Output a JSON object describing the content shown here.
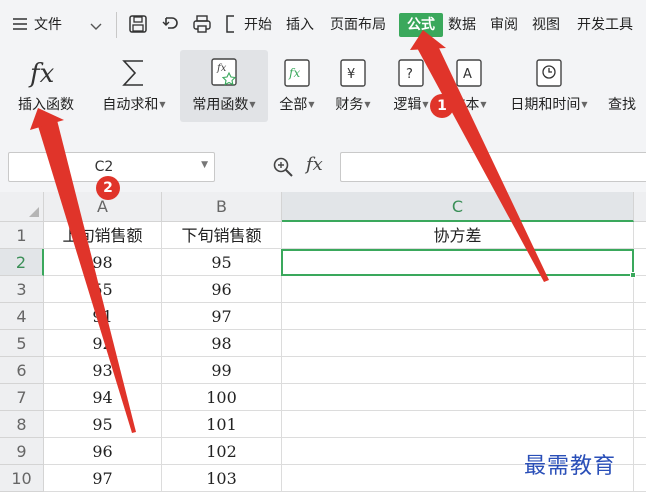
{
  "menubar": {
    "file_label": "文件",
    "tabs": [
      "开始",
      "插入",
      "页面布局",
      "公式",
      "数据",
      "审阅",
      "视图",
      "开发工具"
    ]
  },
  "ribbon": {
    "buttons": [
      "插入函数",
      "自动求和",
      "常用函数",
      "全部",
      "财务",
      "逻辑",
      "文本",
      "日期和时间",
      "查找"
    ]
  },
  "formula_bar": {
    "name_box": "C2",
    "fx_label": "fx",
    "formula": ""
  },
  "sheet": {
    "columns": [
      "A",
      "B",
      "C"
    ],
    "rows": [
      "1",
      "2",
      "3",
      "4",
      "5",
      "6",
      "7",
      "8",
      "9",
      "10"
    ],
    "headers": [
      "上旬销售额",
      "下旬销售额",
      "协方差"
    ],
    "data": [
      [
        "",
        "",
        ""
      ],
      [
        "98",
        "95",
        ""
      ],
      [
        "55",
        "96",
        ""
      ],
      [
        "91",
        "97",
        ""
      ],
      [
        "92",
        "98",
        ""
      ],
      [
        "93",
        "99",
        ""
      ],
      [
        "94",
        "100",
        ""
      ],
      [
        "95",
        "101",
        ""
      ],
      [
        "96",
        "102",
        ""
      ],
      [
        "97",
        "103",
        ""
      ]
    ]
  },
  "annotations": {
    "badge_1": "1",
    "badge_2": "2",
    "arrow_color": "#e0342a"
  },
  "watermark": "最需教育",
  "colors": {
    "accent_green": "#3aa85c",
    "toolbar_bg": "#f3f4f6",
    "watermark_blue": "#2a4fb8"
  }
}
